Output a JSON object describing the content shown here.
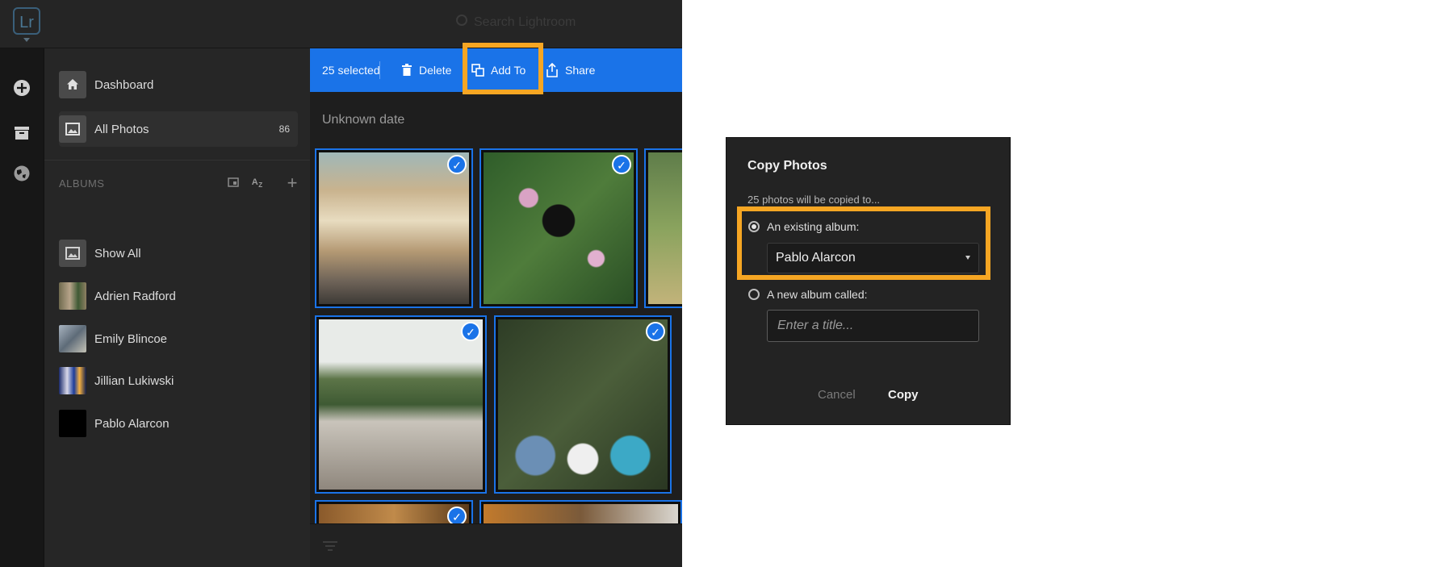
{
  "app": {
    "logo": "Lr",
    "search_placeholder": "Search Lightroom"
  },
  "rail": {
    "icons": [
      "add-icon",
      "library-icon",
      "globe-icon"
    ]
  },
  "sidebar": {
    "items": [
      {
        "label": "Dashboard",
        "icon": "home-icon"
      },
      {
        "label": "All Photos",
        "count": "86",
        "icon": "image-icon"
      }
    ],
    "albums_header": "ALBUMS",
    "albums": [
      {
        "label": "Show All"
      },
      {
        "label": "Adrien Radford"
      },
      {
        "label": "Emily Blincoe"
      },
      {
        "label": "Jillian Lukiwski"
      },
      {
        "label": "Pablo Alarcon"
      }
    ]
  },
  "actionbar": {
    "selected_label": "25 selected",
    "delete_label": "Delete",
    "add_to_label": "Add To",
    "share_label": "Share",
    "color": "#1a73e8"
  },
  "main": {
    "date_label": "Unknown date"
  },
  "highlight_color": "#f6a623",
  "dialog": {
    "title": "Copy Photos",
    "subtitle": "25 photos will be copied to...",
    "existing_label": "An existing album:",
    "selected_album": "Pablo Alarcon",
    "new_label": "A new album called:",
    "title_placeholder": "Enter a title...",
    "cancel_label": "Cancel",
    "copy_label": "Copy"
  }
}
